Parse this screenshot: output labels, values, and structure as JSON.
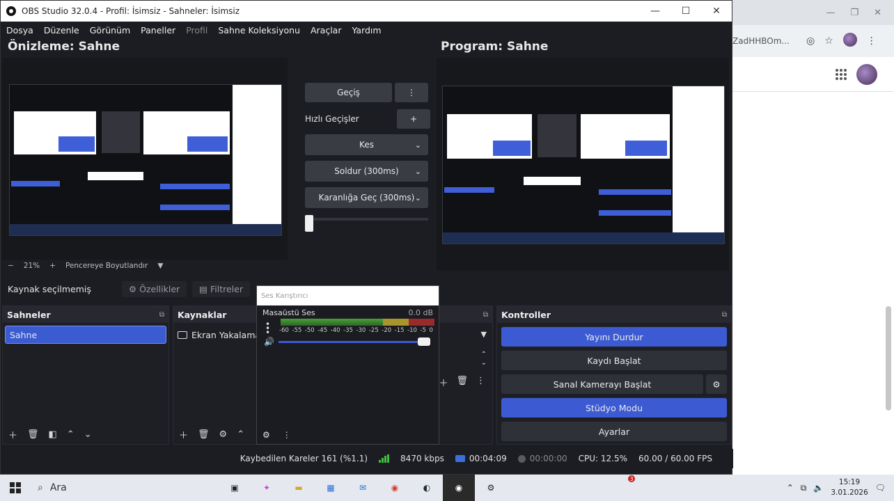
{
  "obs": {
    "title": "OBS Studio 32.0.4 - Profil: İsimsiz - Sahneler: İsimsiz",
    "menu": [
      "Dosya",
      "Düzenle",
      "Görünüm",
      "Paneller",
      "Profil",
      "Sahne Koleksiyonu",
      "Araçlar",
      "Yardım"
    ],
    "preview_label": "Önizleme: Sahne",
    "program_label": "Program: Sahne",
    "zoom": {
      "minus": "−",
      "value": "21%",
      "plus": "+",
      "fit_label": "Pencereye Boyutlandır",
      "caret": "▼"
    },
    "transition": {
      "button_label": "Geçiş",
      "menu_icon": "⋮",
      "quick_label": "Hızlı Geçişler",
      "add_icon": "+",
      "options": [
        "Kes",
        "Soldur (300ms)",
        "Karanlığa Geç (300ms)"
      ]
    },
    "selection": {
      "no_source": "Kaynak seçilmemiş",
      "properties": "Özellikler",
      "filters": "Filtreler"
    },
    "scenes": {
      "title": "Sahneler",
      "items": [
        "Sahne"
      ]
    },
    "sources": {
      "title": "Kaynaklar",
      "items": [
        "Ekran Yakalama"
      ]
    },
    "mixer": {
      "title": "Ses Karıştırıcı",
      "channel": "Masaüstü Ses",
      "level": "0.0 dB",
      "scale": [
        "-60",
        "-55",
        "-50",
        "-45",
        "-40",
        "-35",
        "-30",
        "-25",
        "-20",
        "-15",
        "-10",
        "-5",
        "0"
      ]
    },
    "controls": {
      "title": "Kontroller",
      "stop_stream": "Yayını Durdur",
      "start_record": "Kaydı Başlat",
      "start_vcam": "Sanal Kamerayı Başlat",
      "studio_mode": "Stüdyo Modu",
      "settings": "Ayarlar"
    },
    "status": {
      "dropped": "Kaybedilen Kareler 161 (%1.1)",
      "bitrate": "8470 kbps",
      "stream_time": "00:04:09",
      "record_time": "00:00:00",
      "cpu": "CPU: 12.5%",
      "fps": "60.00 / 60.00 FPS"
    }
  },
  "browser": {
    "url_fragment": "ZadHHBOm..."
  },
  "taskbar": {
    "search_label": "Ara",
    "time": "15:19",
    "date": "3.01.2026",
    "badge": "3"
  },
  "colors": {
    "accent_blue": "#3c5bd3",
    "panel_bg": "#1e1f25",
    "button_bg": "#3a3c44"
  }
}
